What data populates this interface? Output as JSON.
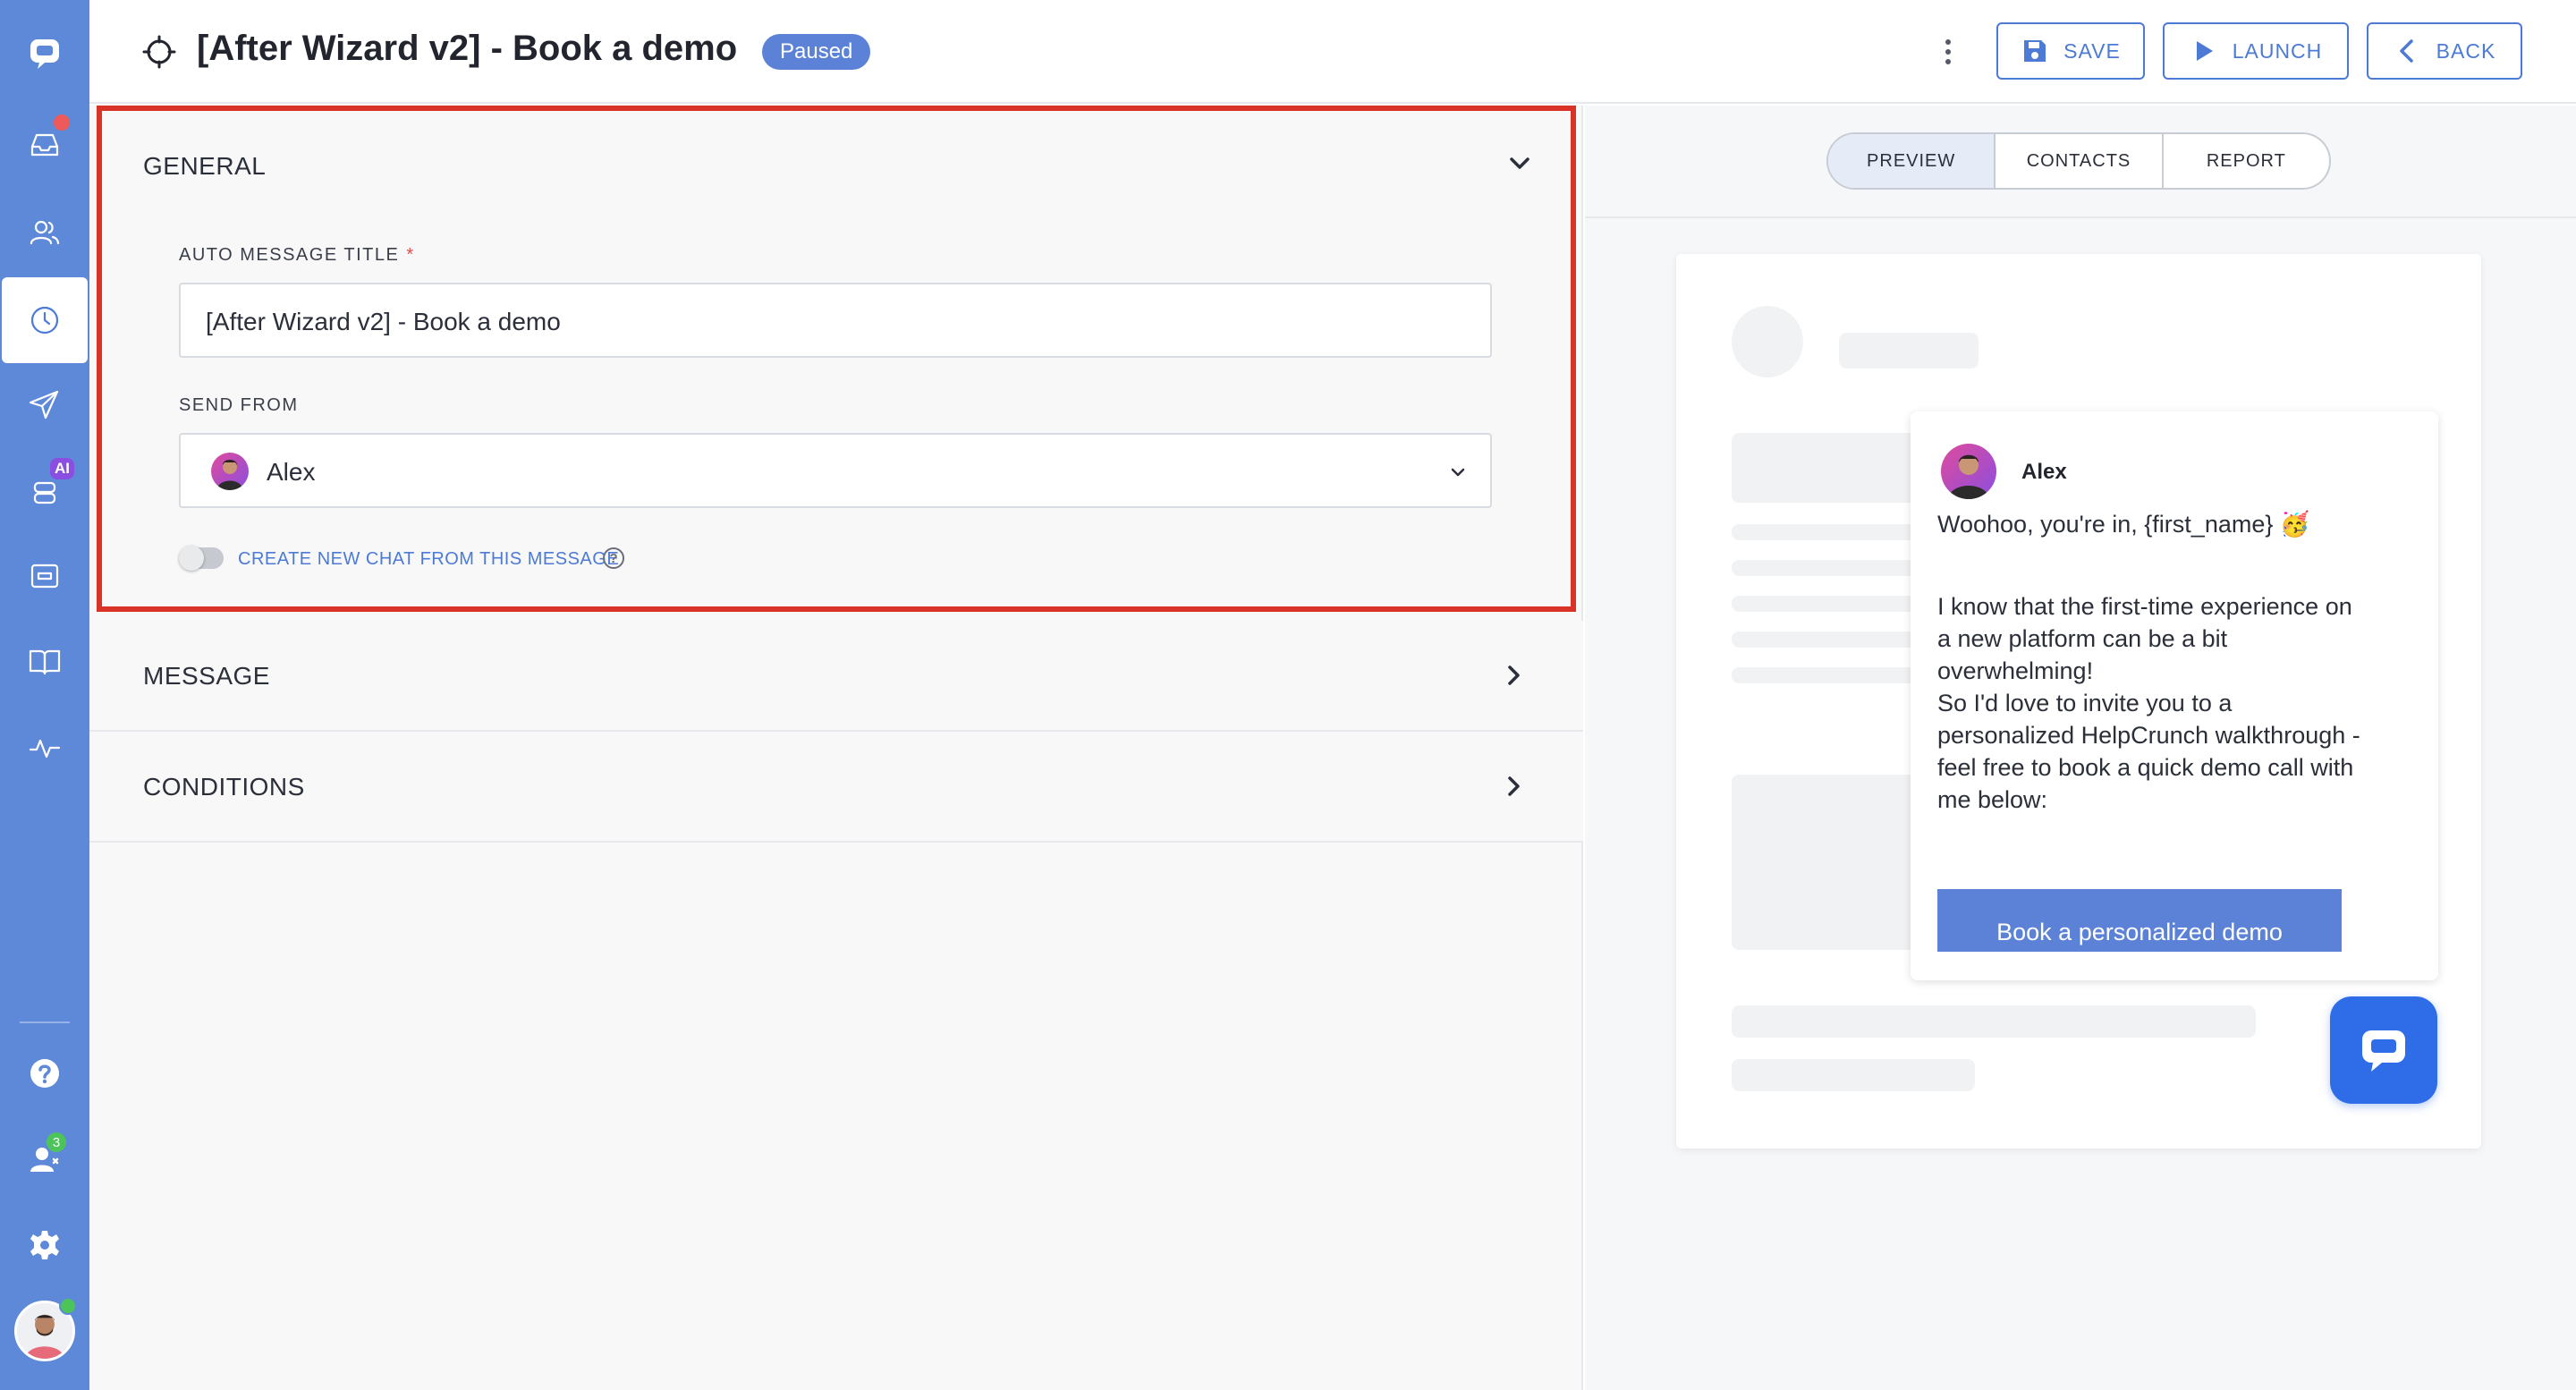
{
  "header": {
    "title": "[After Wizard v2] - Book a demo",
    "status_badge": "Paused",
    "save_label": "SAVE",
    "launch_label": "LAUNCH",
    "back_label": "BACK"
  },
  "nav": {
    "items": [
      {
        "icon": "chat-logo-icon"
      },
      {
        "icon": "inbox-icon"
      },
      {
        "icon": "contacts-icon"
      },
      {
        "icon": "auto-messages-clock-icon"
      },
      {
        "icon": "send-icon"
      },
      {
        "icon": "ai-bot-icon",
        "badge": "AI"
      },
      {
        "icon": "widget-icon"
      },
      {
        "icon": "knowledge-base-book-icon"
      },
      {
        "icon": "activity-icon"
      },
      {
        "icon": "help-icon"
      },
      {
        "icon": "team-icon",
        "badge": "3"
      },
      {
        "icon": "settings-gear-icon"
      }
    ]
  },
  "general": {
    "title": "GENERAL",
    "title_label": "AUTO MESSAGE TITLE",
    "title_required": "*",
    "title_value": "[After Wizard v2] - Book a demo",
    "send_from_label": "SEND FROM",
    "send_from_value": "Alex",
    "toggle_label": "CREATE NEW CHAT FROM THIS MESSAGE",
    "toggle_on": false
  },
  "sections": [
    {
      "title": "MESSAGE"
    },
    {
      "title": "CONDITIONS"
    }
  ],
  "right_tabs": [
    "PREVIEW",
    "CONTACTS",
    "REPORT"
  ],
  "active_tab": "PREVIEW",
  "preview": {
    "sender_name": "Alex",
    "greeting": "Woohoo, you're in, {first_name} 🥳",
    "body_lines": [
      "I know that the first-time experience on",
      "a new platform can be a bit",
      "overwhelming!",
      "So I'd love to invite you to a",
      "personalized HelpCrunch walkthrough -",
      "feel free to book a quick demo call with",
      "me below:"
    ],
    "button_label": "Book a personalized demo"
  },
  "colors": {
    "nav_bg": "#5e89d9",
    "accent": "#4c7ad5",
    "highlight_border": "#d93327",
    "badge_bg": "#5b82d6",
    "chat_fab": "#2f6ce8"
  }
}
